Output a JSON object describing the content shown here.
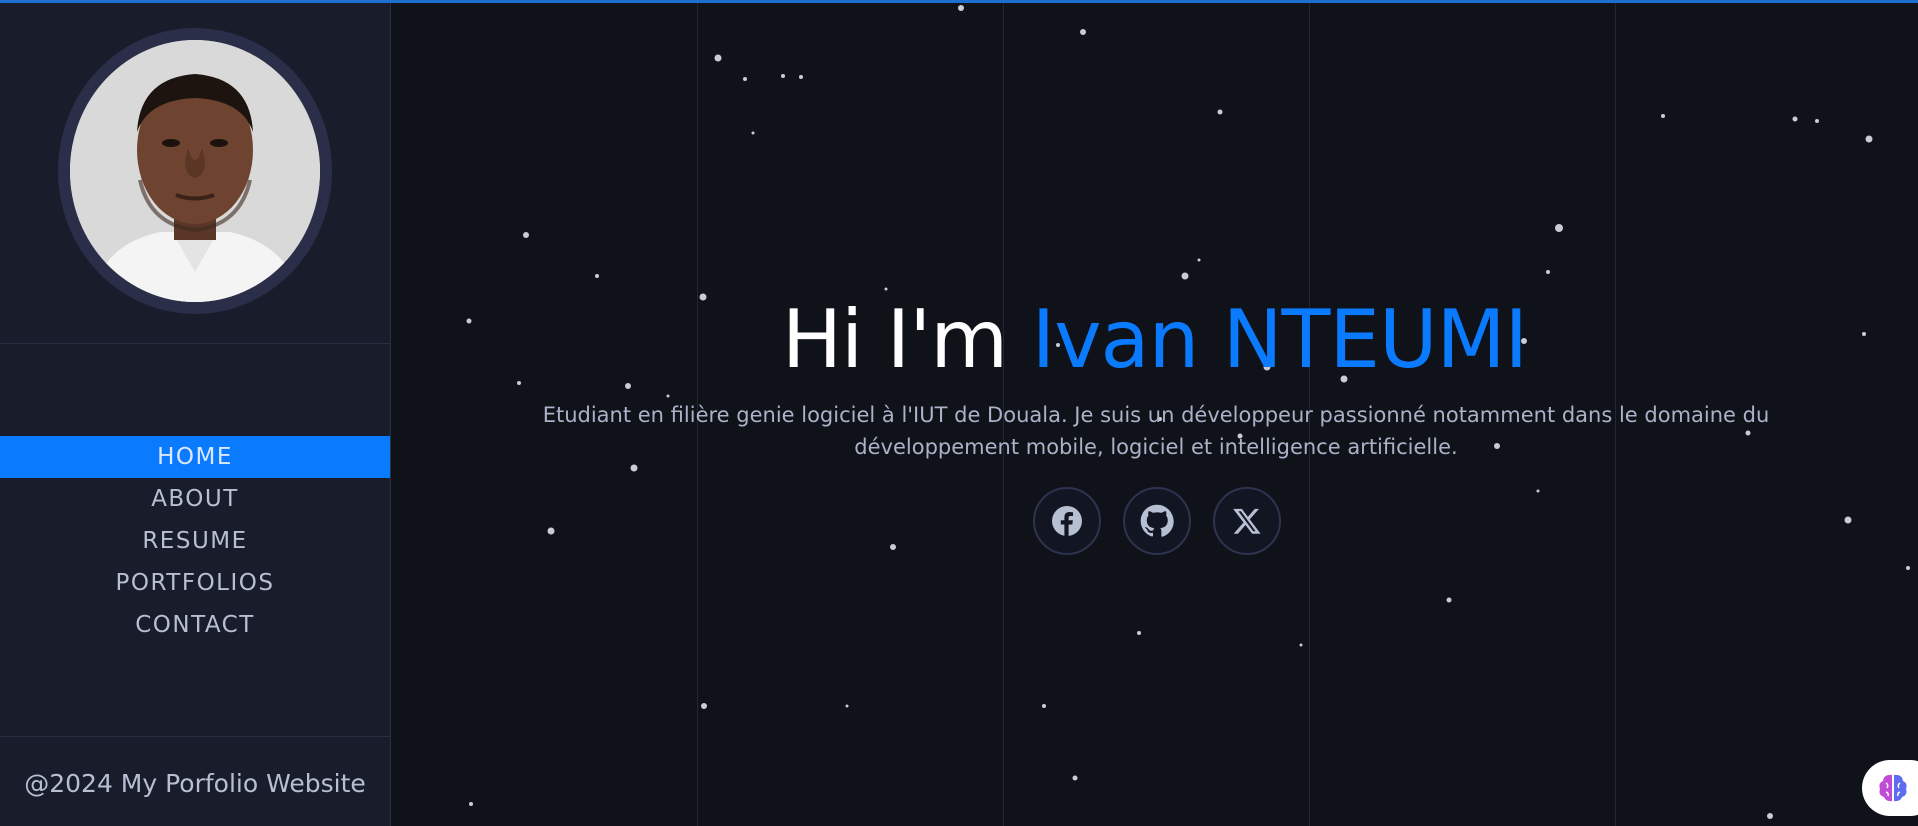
{
  "sidebar": {
    "profile_photo": "profile-photo",
    "nav": [
      {
        "label": "HOME",
        "active": true
      },
      {
        "label": "ABOUT",
        "active": false
      },
      {
        "label": "RESUME",
        "active": false
      },
      {
        "label": "PORTFOLIOS",
        "active": false
      },
      {
        "label": "CONTACT",
        "active": false
      }
    ],
    "footer": "@2024 My Porfolio Website"
  },
  "hero": {
    "greeting": "Hi I'm ",
    "name": "Ivan NTEUMI",
    "subtitle": "Etudiant en filière genie logiciel à l'IUT de Douala. Je suis un développeur passionné notamment dans le domaine du développement mobile, logiciel et intelligence artificielle."
  },
  "socials": [
    {
      "icon": "facebook-icon"
    },
    {
      "icon": "github-icon"
    },
    {
      "icon": "x-icon"
    }
  ],
  "colors": {
    "accent": "#0a7bff",
    "sidebar_bg": "#191c2b",
    "main_bg": "#10121a",
    "text_muted": "#b7bfd3"
  }
}
